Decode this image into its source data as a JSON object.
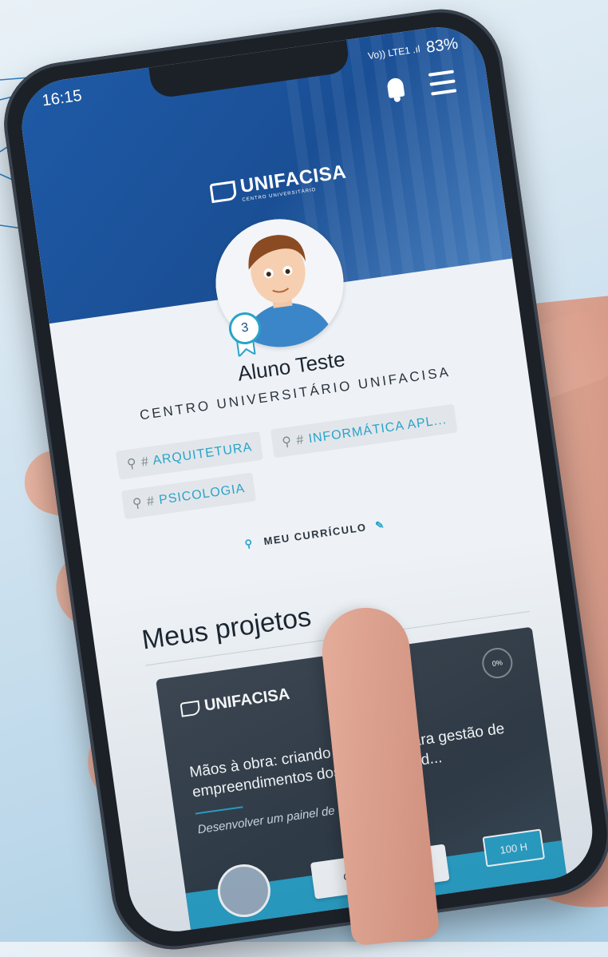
{
  "status_bar": {
    "time": "16:15",
    "signal": "Vo)) LTE1 .ıl",
    "battery": "83%"
  },
  "header": {
    "logo_text": "UNIFACISA",
    "logo_sub": "CENTRO UNIVERSITÁRIO"
  },
  "profile": {
    "level_badge": "3",
    "name": "Aluno Teste",
    "institution": "CENTRO UNIVERSITÁRIO UNIFACISA",
    "tags": [
      "ARQUITETURA",
      "INFORMÁTICA APL...",
      "PSICOLOGIA"
    ],
    "curriculum_label": "MEU CURRÍCULO"
  },
  "projects": {
    "section_title": "Meus projetos",
    "card": {
      "logo_text": "UNIFACISA",
      "progress": "0%",
      "title": "Mãos à obra: criando um painel para gestão de empreendimentos dos moradores d...",
      "description": "Desenvolver um painel de",
      "level_button": "GRADUAÇÃO",
      "hours": "100 H"
    }
  },
  "colors": {
    "accent": "#2aa3c9",
    "header_blue": "#1f5aa6",
    "card_dark": "#2f3943"
  },
  "icons": [
    "bell-icon",
    "menu-icon",
    "ribbon-icon",
    "pencil-icon",
    "user-icon"
  ]
}
